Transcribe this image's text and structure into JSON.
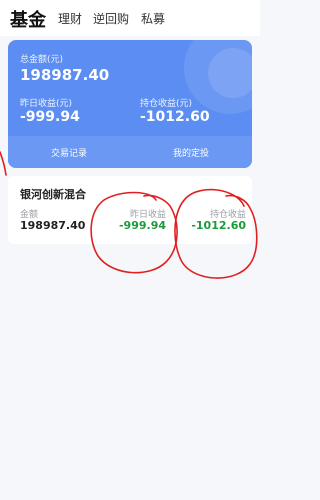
{
  "tabs": [
    {
      "label": "基金"
    },
    {
      "label": "理财"
    },
    {
      "label": "逆回购"
    },
    {
      "label": "私募"
    }
  ],
  "summary": {
    "total_label": "总金额(元)",
    "total_value": "198987.40",
    "yesterday_label": "昨日收益(元)",
    "yesterday_value": "-999.94",
    "holding_label": "持仓收益(元)",
    "holding_value": "-1012.60",
    "actions": [
      {
        "label": "交易记录"
      },
      {
        "label": "我的定投"
      }
    ]
  },
  "fund": {
    "name": "银河创新混合",
    "amount_label": "金额",
    "amount_value": "198987.40",
    "yesterday_label": "昨日收益",
    "yesterday_value": "-999.94",
    "holding_label": "持仓收益",
    "holding_value": "-1012.60"
  },
  "colors": {
    "card_blue": "#5b8df2",
    "gain_green": "#1a9b3a",
    "annotation_red": "#e02020"
  }
}
